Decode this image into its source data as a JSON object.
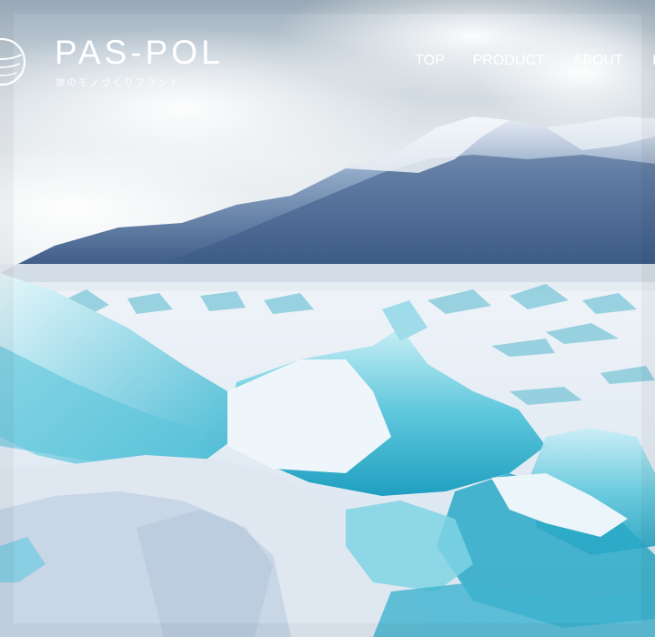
{
  "header": {
    "brand": "PAS-POL",
    "tagline": "旅のモノづくりブランド",
    "nav": [
      {
        "label": "TOP"
      },
      {
        "label": "PRODUCT"
      },
      {
        "label": "ABOUT"
      },
      {
        "label": "I"
      }
    ]
  },
  "hero": {
    "image": "frozen-lake-ice-mountains"
  },
  "colors": {
    "text": "#ffffff",
    "ice": "#5cc6d8",
    "sky": "#d8e4ec",
    "mountain": "#3d5e8c"
  }
}
